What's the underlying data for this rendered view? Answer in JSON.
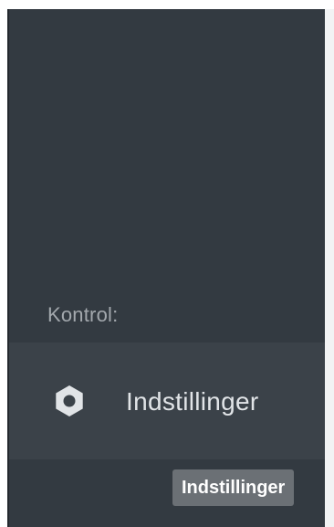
{
  "sidebar": {
    "section_label": "Kontrol:",
    "items": [
      {
        "label": "Indstillinger",
        "icon": "gear-icon"
      }
    ]
  },
  "tooltip": {
    "text": "Indstillinger"
  },
  "colors": {
    "sidebar_bg": "#333a41",
    "item_bg": "#3b4249",
    "label_text": "#a3a8ad",
    "item_text": "#e1e4e7",
    "tooltip_bg": "#6b7075"
  }
}
